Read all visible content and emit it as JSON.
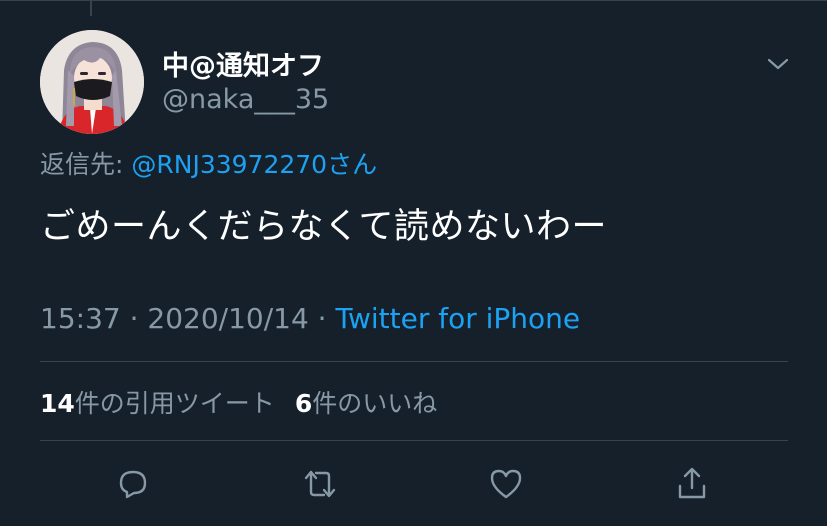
{
  "tweet": {
    "author_name": "中@通知オフ",
    "author_handle": "@naka___35",
    "reply_prefix": "返信先:",
    "reply_mention": "@RNJ33972270さん",
    "text": "ごめーんくだらなくて読めないわー",
    "timestamp": "15:37 · 2020/10/14 · ",
    "source": "Twitter for iPhone"
  },
  "stats": {
    "quote_count": "14",
    "quote_label": "件の引用ツイート",
    "like_count": "6",
    "like_label": "件のいいね"
  },
  "actions": {
    "icons": [
      "reply-icon",
      "retweet-icon",
      "like-icon",
      "share-icon"
    ]
  },
  "colors": {
    "background": "#15202b",
    "accent": "#1da1f2",
    "secondary_text": "#8899a6",
    "divider": "#38444d"
  }
}
